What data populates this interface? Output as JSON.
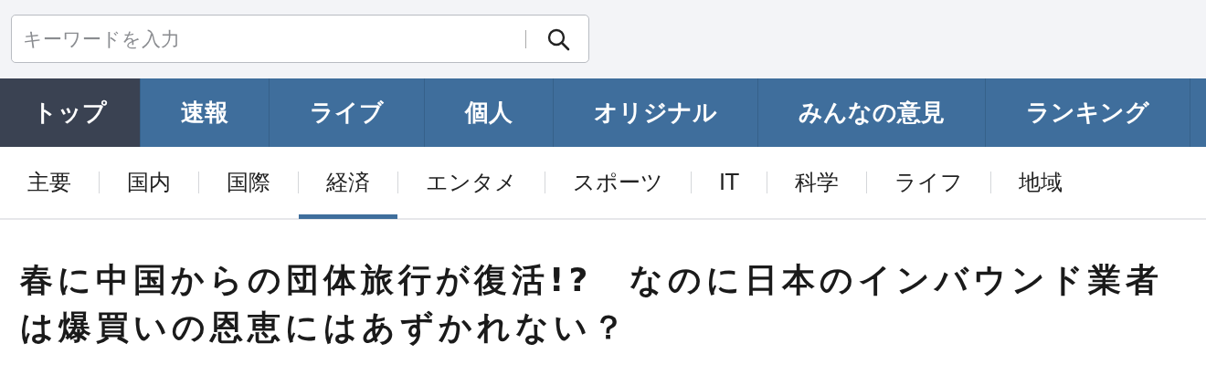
{
  "search": {
    "placeholder": "キーワードを入力"
  },
  "main_nav": [
    {
      "label": "トップ",
      "selected": true
    },
    {
      "label": "速報",
      "selected": false
    },
    {
      "label": "ライブ",
      "selected": false
    },
    {
      "label": "個人",
      "selected": false
    },
    {
      "label": "オリジナル",
      "selected": false
    },
    {
      "label": "みんなの意見",
      "selected": false
    },
    {
      "label": "ランキング",
      "selected": false
    }
  ],
  "category_nav": [
    {
      "label": "主要",
      "selected": false
    },
    {
      "label": "国内",
      "selected": false
    },
    {
      "label": "国際",
      "selected": false
    },
    {
      "label": "経済",
      "selected": true
    },
    {
      "label": "エンタメ",
      "selected": false
    },
    {
      "label": "スポーツ",
      "selected": false
    },
    {
      "label": "IT",
      "selected": false
    },
    {
      "label": "科学",
      "selected": false
    },
    {
      "label": "ライフ",
      "selected": false
    },
    {
      "label": "地域",
      "selected": false
    }
  ],
  "article": {
    "headline": "春に中国からの団体旅行が復活!?　なのに日本のインバウンド業者は爆買いの恩恵にはあずかれない？"
  }
}
